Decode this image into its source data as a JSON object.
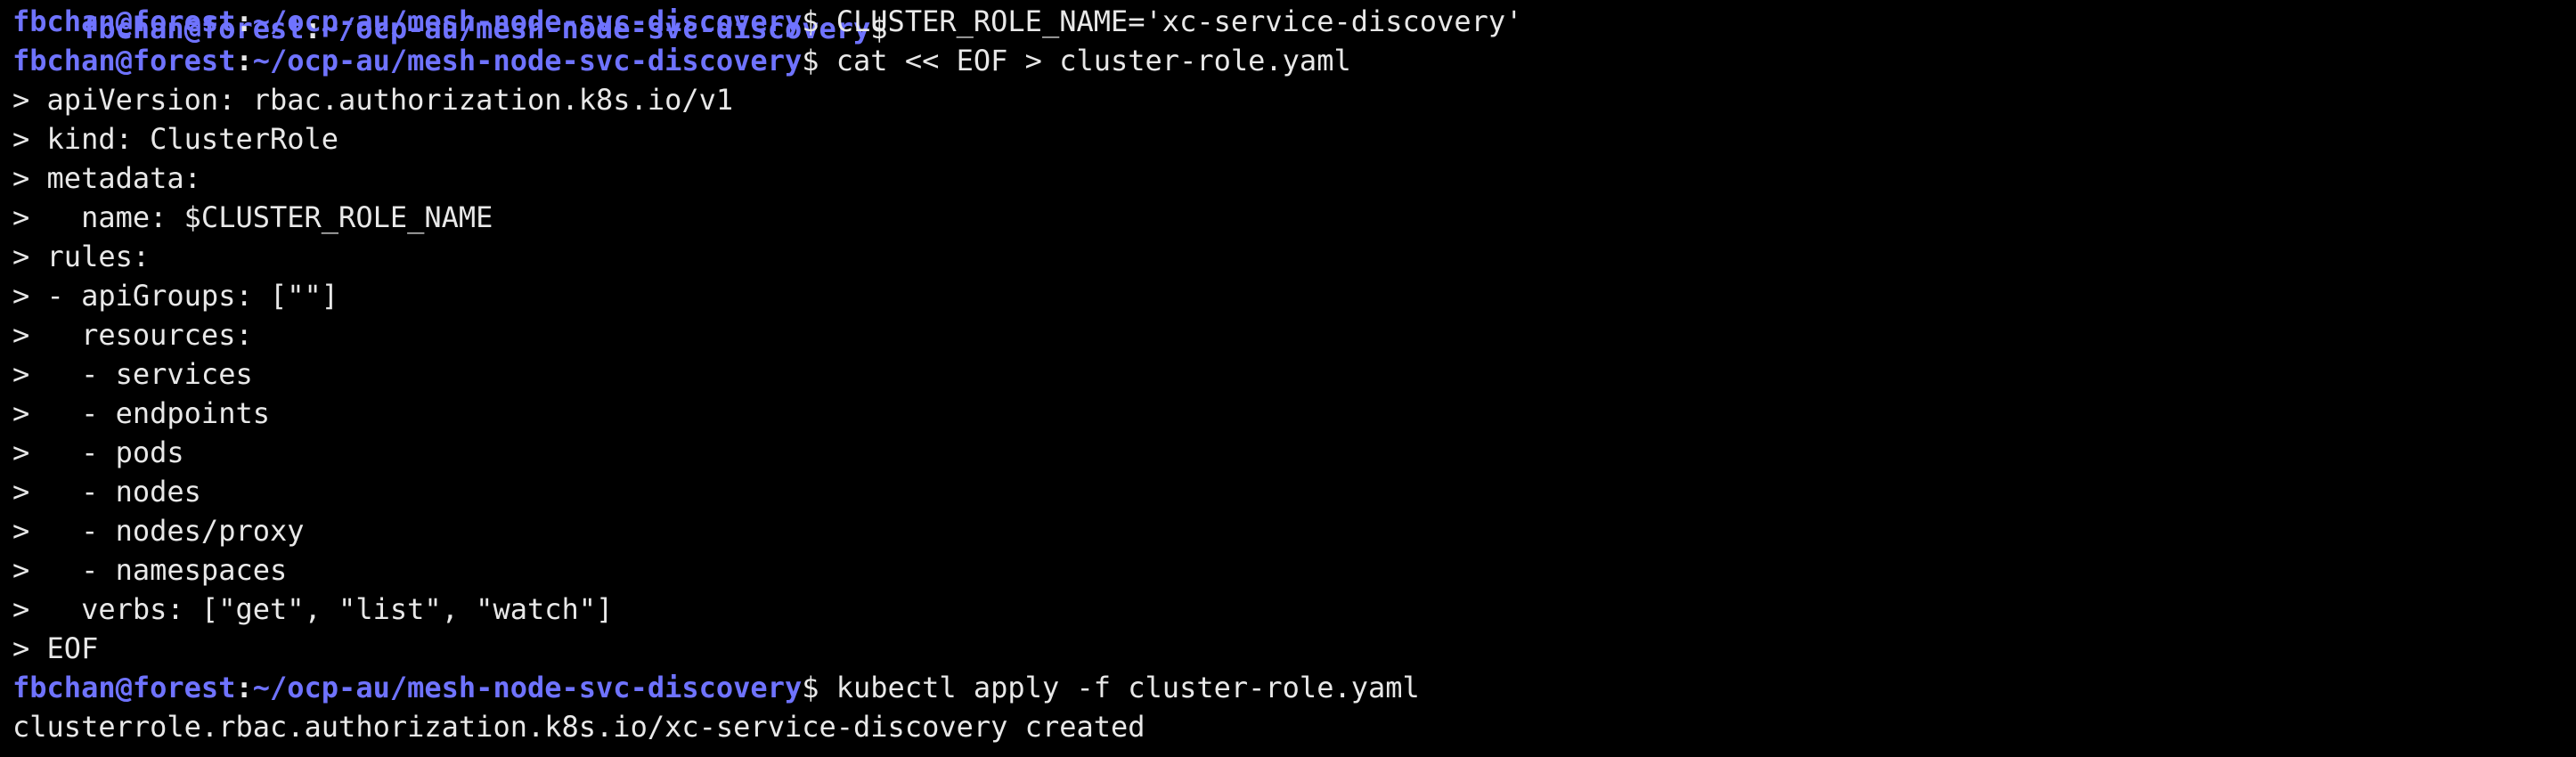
{
  "colors": {
    "background": "#000000",
    "prompt_user": "#6f73ff",
    "prompt_path": "#6f73ff",
    "text": "#e8e8e8"
  },
  "terminal": {
    "cut_top": {
      "user": "fbchan@forest",
      "colon": ":",
      "path": "~/ocp-au/mesh-node-svc-discovery",
      "dollar": "$"
    },
    "lines": [
      {
        "kind": "prompt",
        "user": "fbchan@forest",
        "colon": ":",
        "path": "~/ocp-au/mesh-node-svc-discovery",
        "dollar": "$",
        "command": " CLUSTER_ROLE_NAME='xc-service-discovery'"
      },
      {
        "kind": "prompt",
        "user": "fbchan@forest",
        "colon": ":",
        "path": "~/ocp-au/mesh-node-svc-discovery",
        "dollar": "$",
        "command": " cat << EOF > cluster-role.yaml"
      },
      {
        "kind": "output",
        "text": "> apiVersion: rbac.authorization.k8s.io/v1"
      },
      {
        "kind": "output",
        "text": "> kind: ClusterRole"
      },
      {
        "kind": "output",
        "text": "> metadata:"
      },
      {
        "kind": "output",
        "text": ">   name: $CLUSTER_ROLE_NAME"
      },
      {
        "kind": "output",
        "text": "> rules:"
      },
      {
        "kind": "output",
        "text": "> - apiGroups: [\"\"]"
      },
      {
        "kind": "output",
        "text": ">   resources:"
      },
      {
        "kind": "output",
        "text": ">   - services"
      },
      {
        "kind": "output",
        "text": ">   - endpoints"
      },
      {
        "kind": "output",
        "text": ">   - pods"
      },
      {
        "kind": "output",
        "text": ">   - nodes"
      },
      {
        "kind": "output",
        "text": ">   - nodes/proxy"
      },
      {
        "kind": "output",
        "text": ">   - namespaces"
      },
      {
        "kind": "output",
        "text": ">   verbs: [\"get\", \"list\", \"watch\"]"
      },
      {
        "kind": "output",
        "text": "> EOF"
      },
      {
        "kind": "prompt",
        "user": "fbchan@forest",
        "colon": ":",
        "path": "~/ocp-au/mesh-node-svc-discovery",
        "dollar": "$",
        "command": " kubectl apply -f cluster-role.yaml"
      },
      {
        "kind": "output",
        "text": "clusterrole.rbac.authorization.k8s.io/xc-service-discovery created"
      }
    ]
  }
}
